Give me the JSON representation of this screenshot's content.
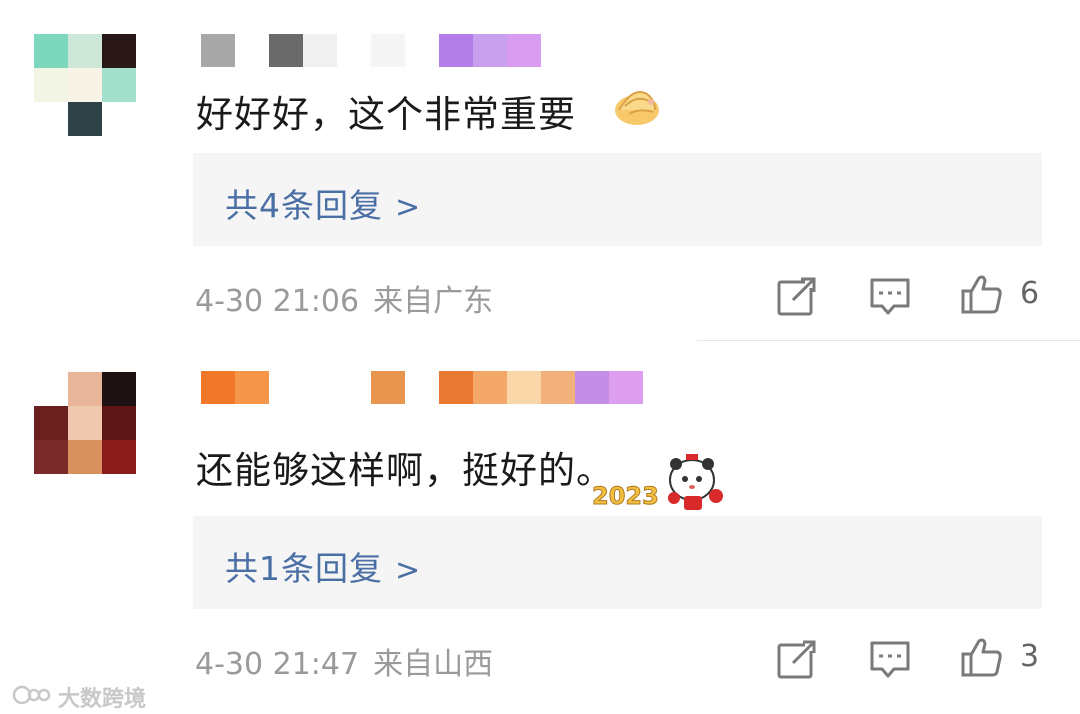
{
  "comments": [
    {
      "text": "好好好，这个非常重要",
      "sticker_icon": "pinched-fingers-emoji",
      "replies_label": "共4条回复",
      "replies_arrow": ">",
      "time": "4-30 21:06",
      "location": "来自广东",
      "like_count": "6",
      "avatar_palette": [
        "#7dd7bc",
        "#cde8d8",
        "#2a1818",
        "#f2f5e4",
        "#f8f3e6",
        "#a3e0cc",
        "#ffffff",
        "#2f4248",
        "#ffffff"
      ],
      "username_palette": [
        "#a8a8a8",
        "#ffffff",
        "#6a6a6a",
        "#f0f0f0",
        "#ffffff",
        "#f5f5f5",
        "#ffffff",
        "#b47ee8",
        "#c9a0ee",
        "#d89cf0"
      ]
    },
    {
      "text": "还能够这样啊，挺好的。",
      "sticker_icon": "panda-2023-sticker",
      "sticker_text": "2023",
      "replies_label": "共1条回复",
      "replies_arrow": ">",
      "time": "4-30 21:47",
      "location": "来自山西",
      "like_count": "3",
      "avatar_palette": [
        "#ffffff",
        "#e9b59a",
        "#1d1111",
        "#6b1f1f",
        "#f0c8b0",
        "#5e1515",
        "#7a2a2a",
        "#d9905f",
        "#8a1b1b"
      ],
      "username_palette": [
        "#f07828",
        "#f5964a",
        "#ffffff",
        "#ffffff",
        "#ffffff",
        "#e89550",
        "#ffffff",
        "#e87832",
        "#f3a86a",
        "#fad7a8",
        "#f2b07c",
        "#c58ee6",
        "#dd9ef0"
      ]
    }
  ],
  "icons": {
    "share": "share-icon",
    "comment": "comment-icon",
    "like": "thumbs-up-icon"
  },
  "colors": {
    "reply_link": "#4a6fa5",
    "meta_text": "#9a9a9a",
    "reply_bg": "#f5f5f5"
  },
  "watermark": {
    "text": "大数跨境"
  }
}
